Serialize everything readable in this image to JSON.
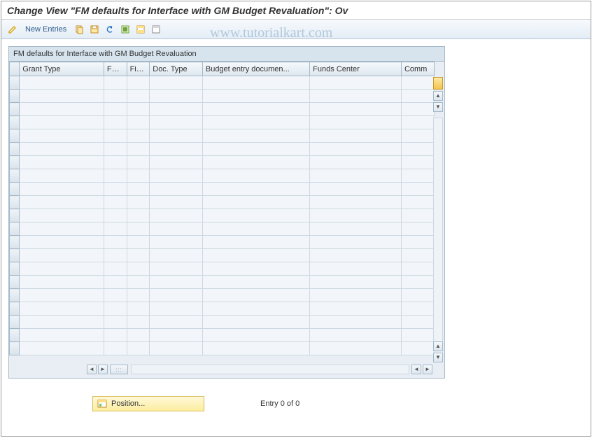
{
  "title": "Change View \"FM defaults for Interface with GM Budget Revaluation\": Ov",
  "toolbar": {
    "new_entries_label": "New Entries"
  },
  "panel": {
    "title": "FM defaults for Interface with GM Budget Revaluation"
  },
  "columns": {
    "grant_type": "Grant Type",
    "fm": "FM...",
    "fis": "Fis...",
    "doc_type": "Doc. Type",
    "budget_entry": "Budget entry documen...",
    "funds_center": "Funds Center",
    "comm": "Comm"
  },
  "footer": {
    "position_label": "Position...",
    "entry_text": "Entry 0 of 0"
  },
  "watermark": "www.tutorialkart.com"
}
